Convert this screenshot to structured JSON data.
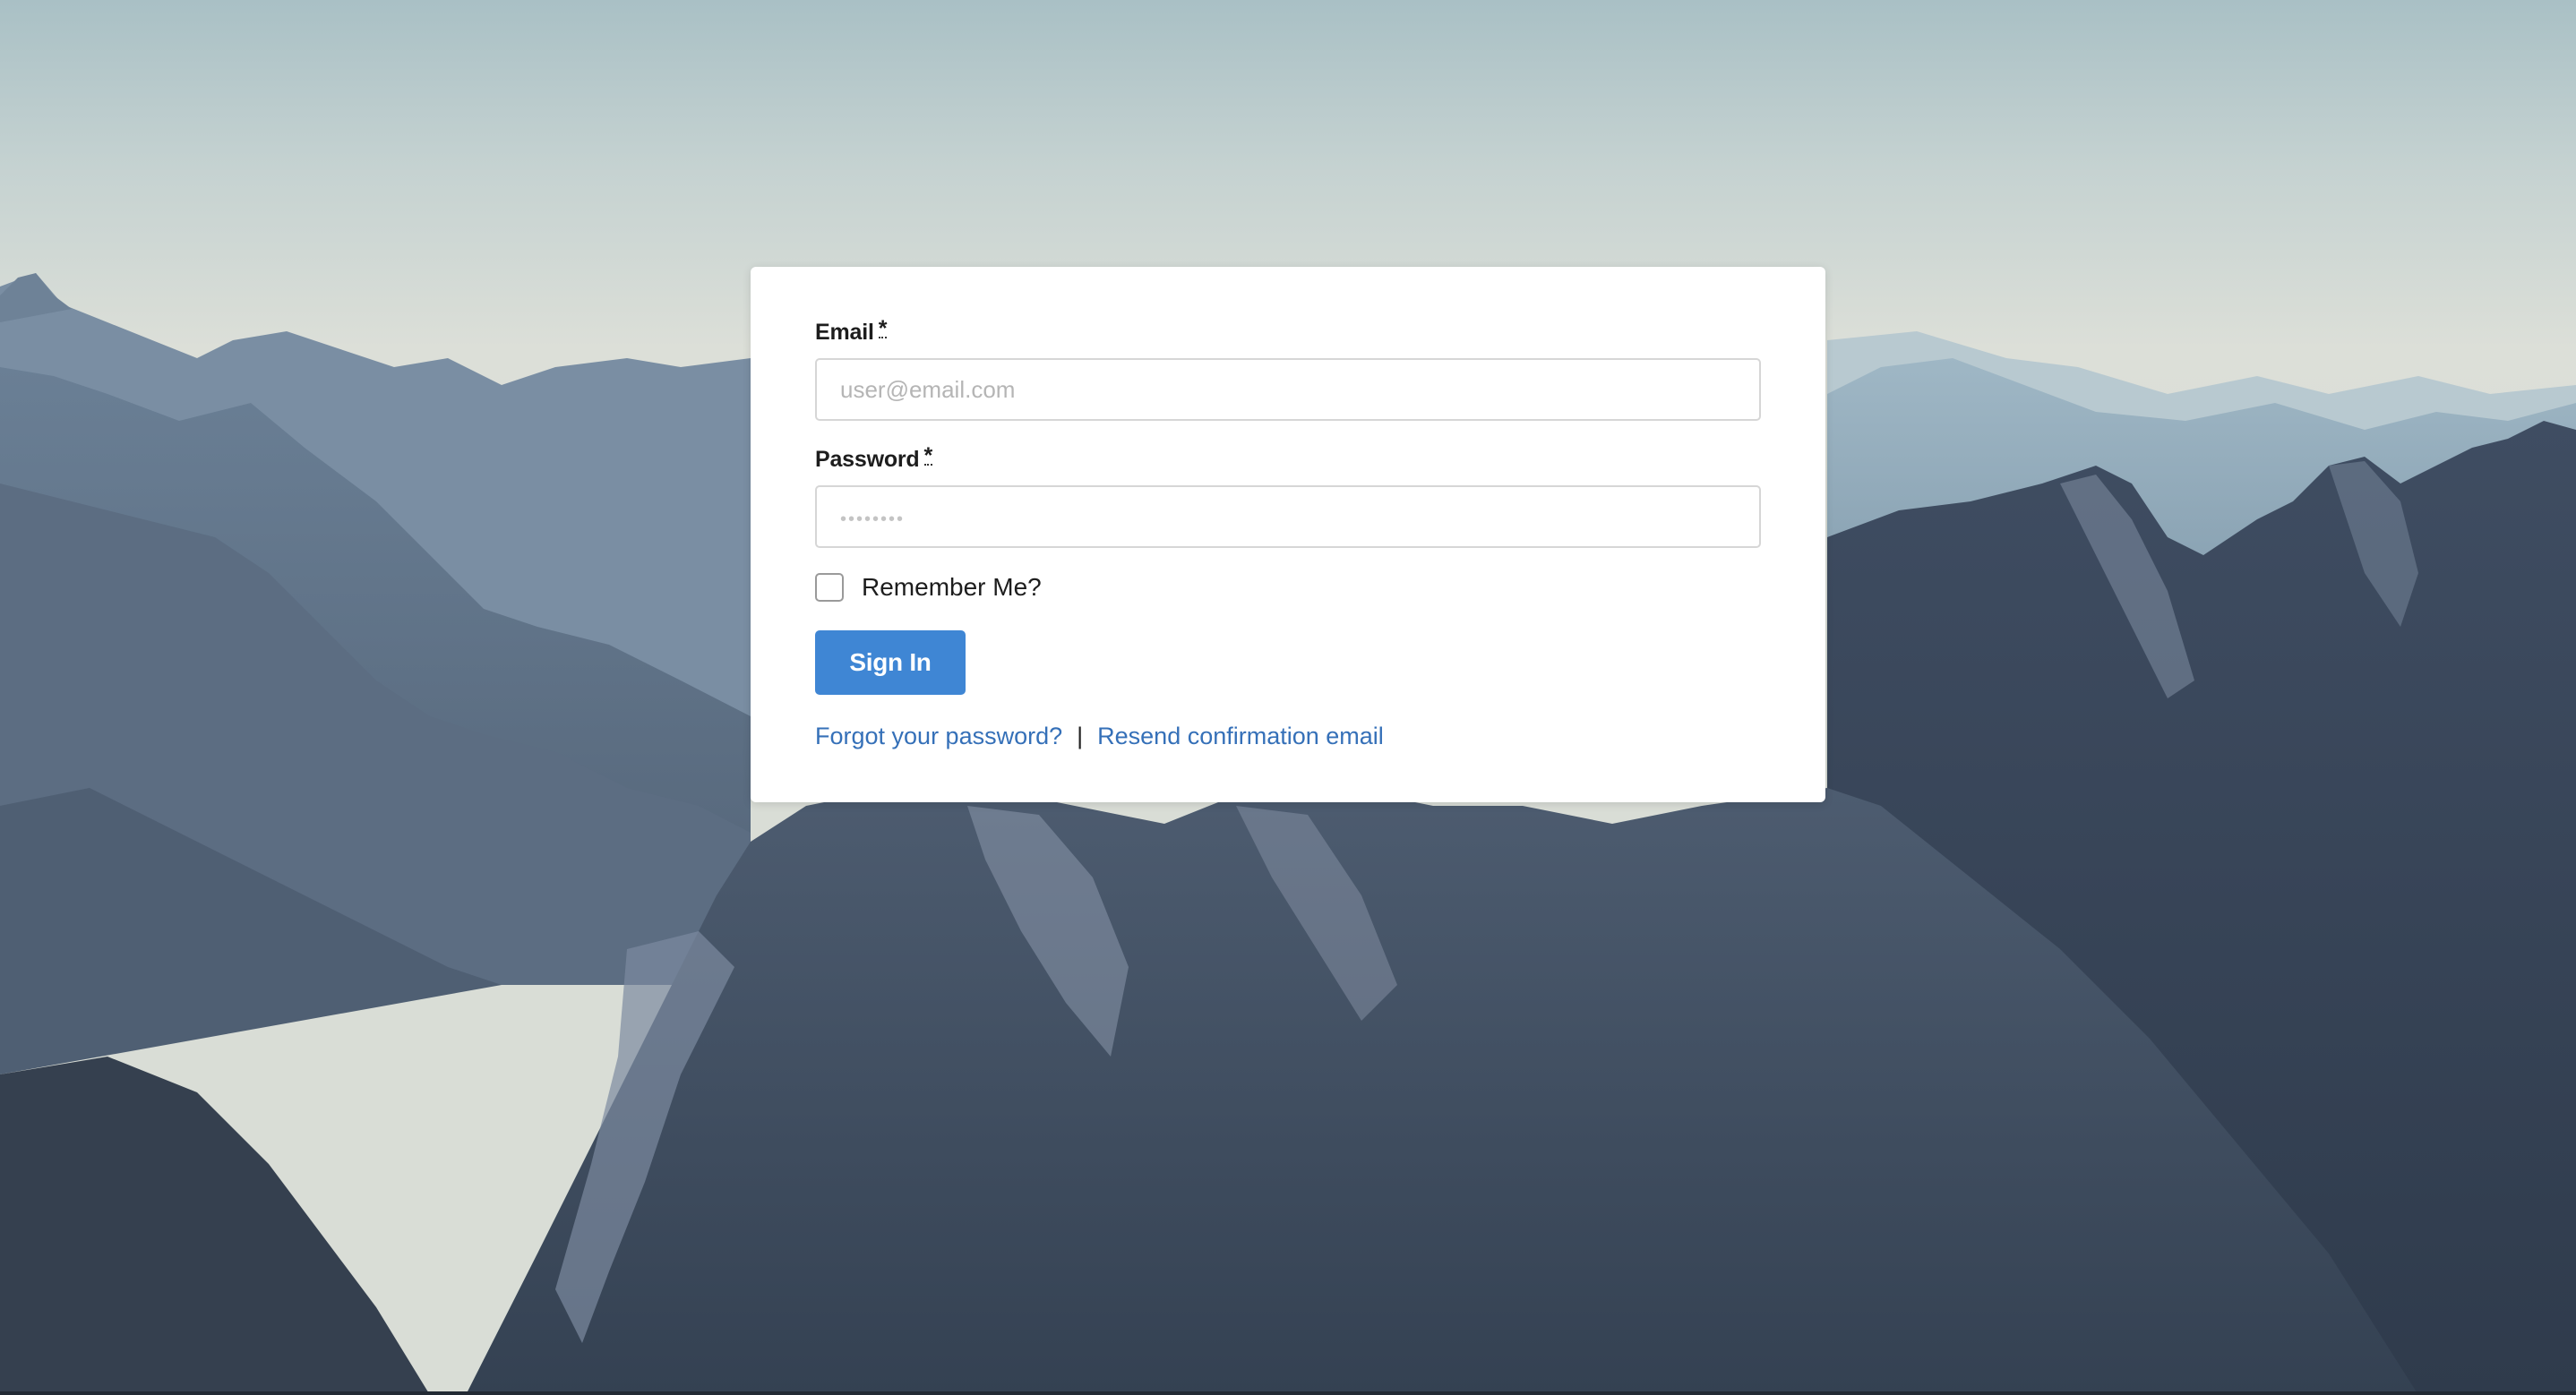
{
  "form": {
    "email_label": "Email",
    "email_required_marker": "*",
    "email_placeholder": "user@email.com",
    "password_label": "Password",
    "password_required_marker": "*",
    "password_placeholder": "••••••••",
    "remember_label": "Remember Me?",
    "remember_checked": false,
    "submit_label": "Sign In"
  },
  "links": {
    "forgot_password": "Forgot your password?",
    "separator": "|",
    "resend_confirmation": "Resend confirmation email"
  },
  "colors": {
    "primary_button": "#3f86d4",
    "link": "#3570b8",
    "card_background": "#ffffff"
  },
  "background": {
    "subject": "mountain-landscape"
  }
}
